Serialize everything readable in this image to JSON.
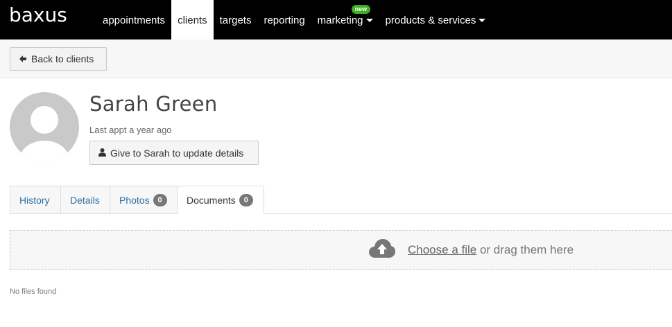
{
  "brand": {
    "logo": "baxus"
  },
  "nav": {
    "items": [
      {
        "label": "appointments"
      },
      {
        "label": "clients"
      },
      {
        "label": "targets"
      },
      {
        "label": "reporting"
      },
      {
        "label": "marketing",
        "badge": "new"
      },
      {
        "label": "products & services"
      }
    ]
  },
  "toolbar": {
    "back_label": "Back to clients"
  },
  "profile": {
    "name": "Sarah Green",
    "last_appt": "Last appt a year ago",
    "update_button_label": "Give to Sarah to update details"
  },
  "tabs": [
    {
      "label": "History"
    },
    {
      "label": "Details"
    },
    {
      "label": "Photos",
      "count": "0"
    },
    {
      "label": "Documents",
      "count": "0"
    }
  ],
  "documents": {
    "choose_file_label": "Choose a file",
    "drag_text": " or drag them here",
    "empty_text": "No files found"
  },
  "colors": {
    "nav_bg": "#000000",
    "link": "#2a6fa6",
    "new_badge": "#3cb021",
    "count_badge": "#777777"
  }
}
